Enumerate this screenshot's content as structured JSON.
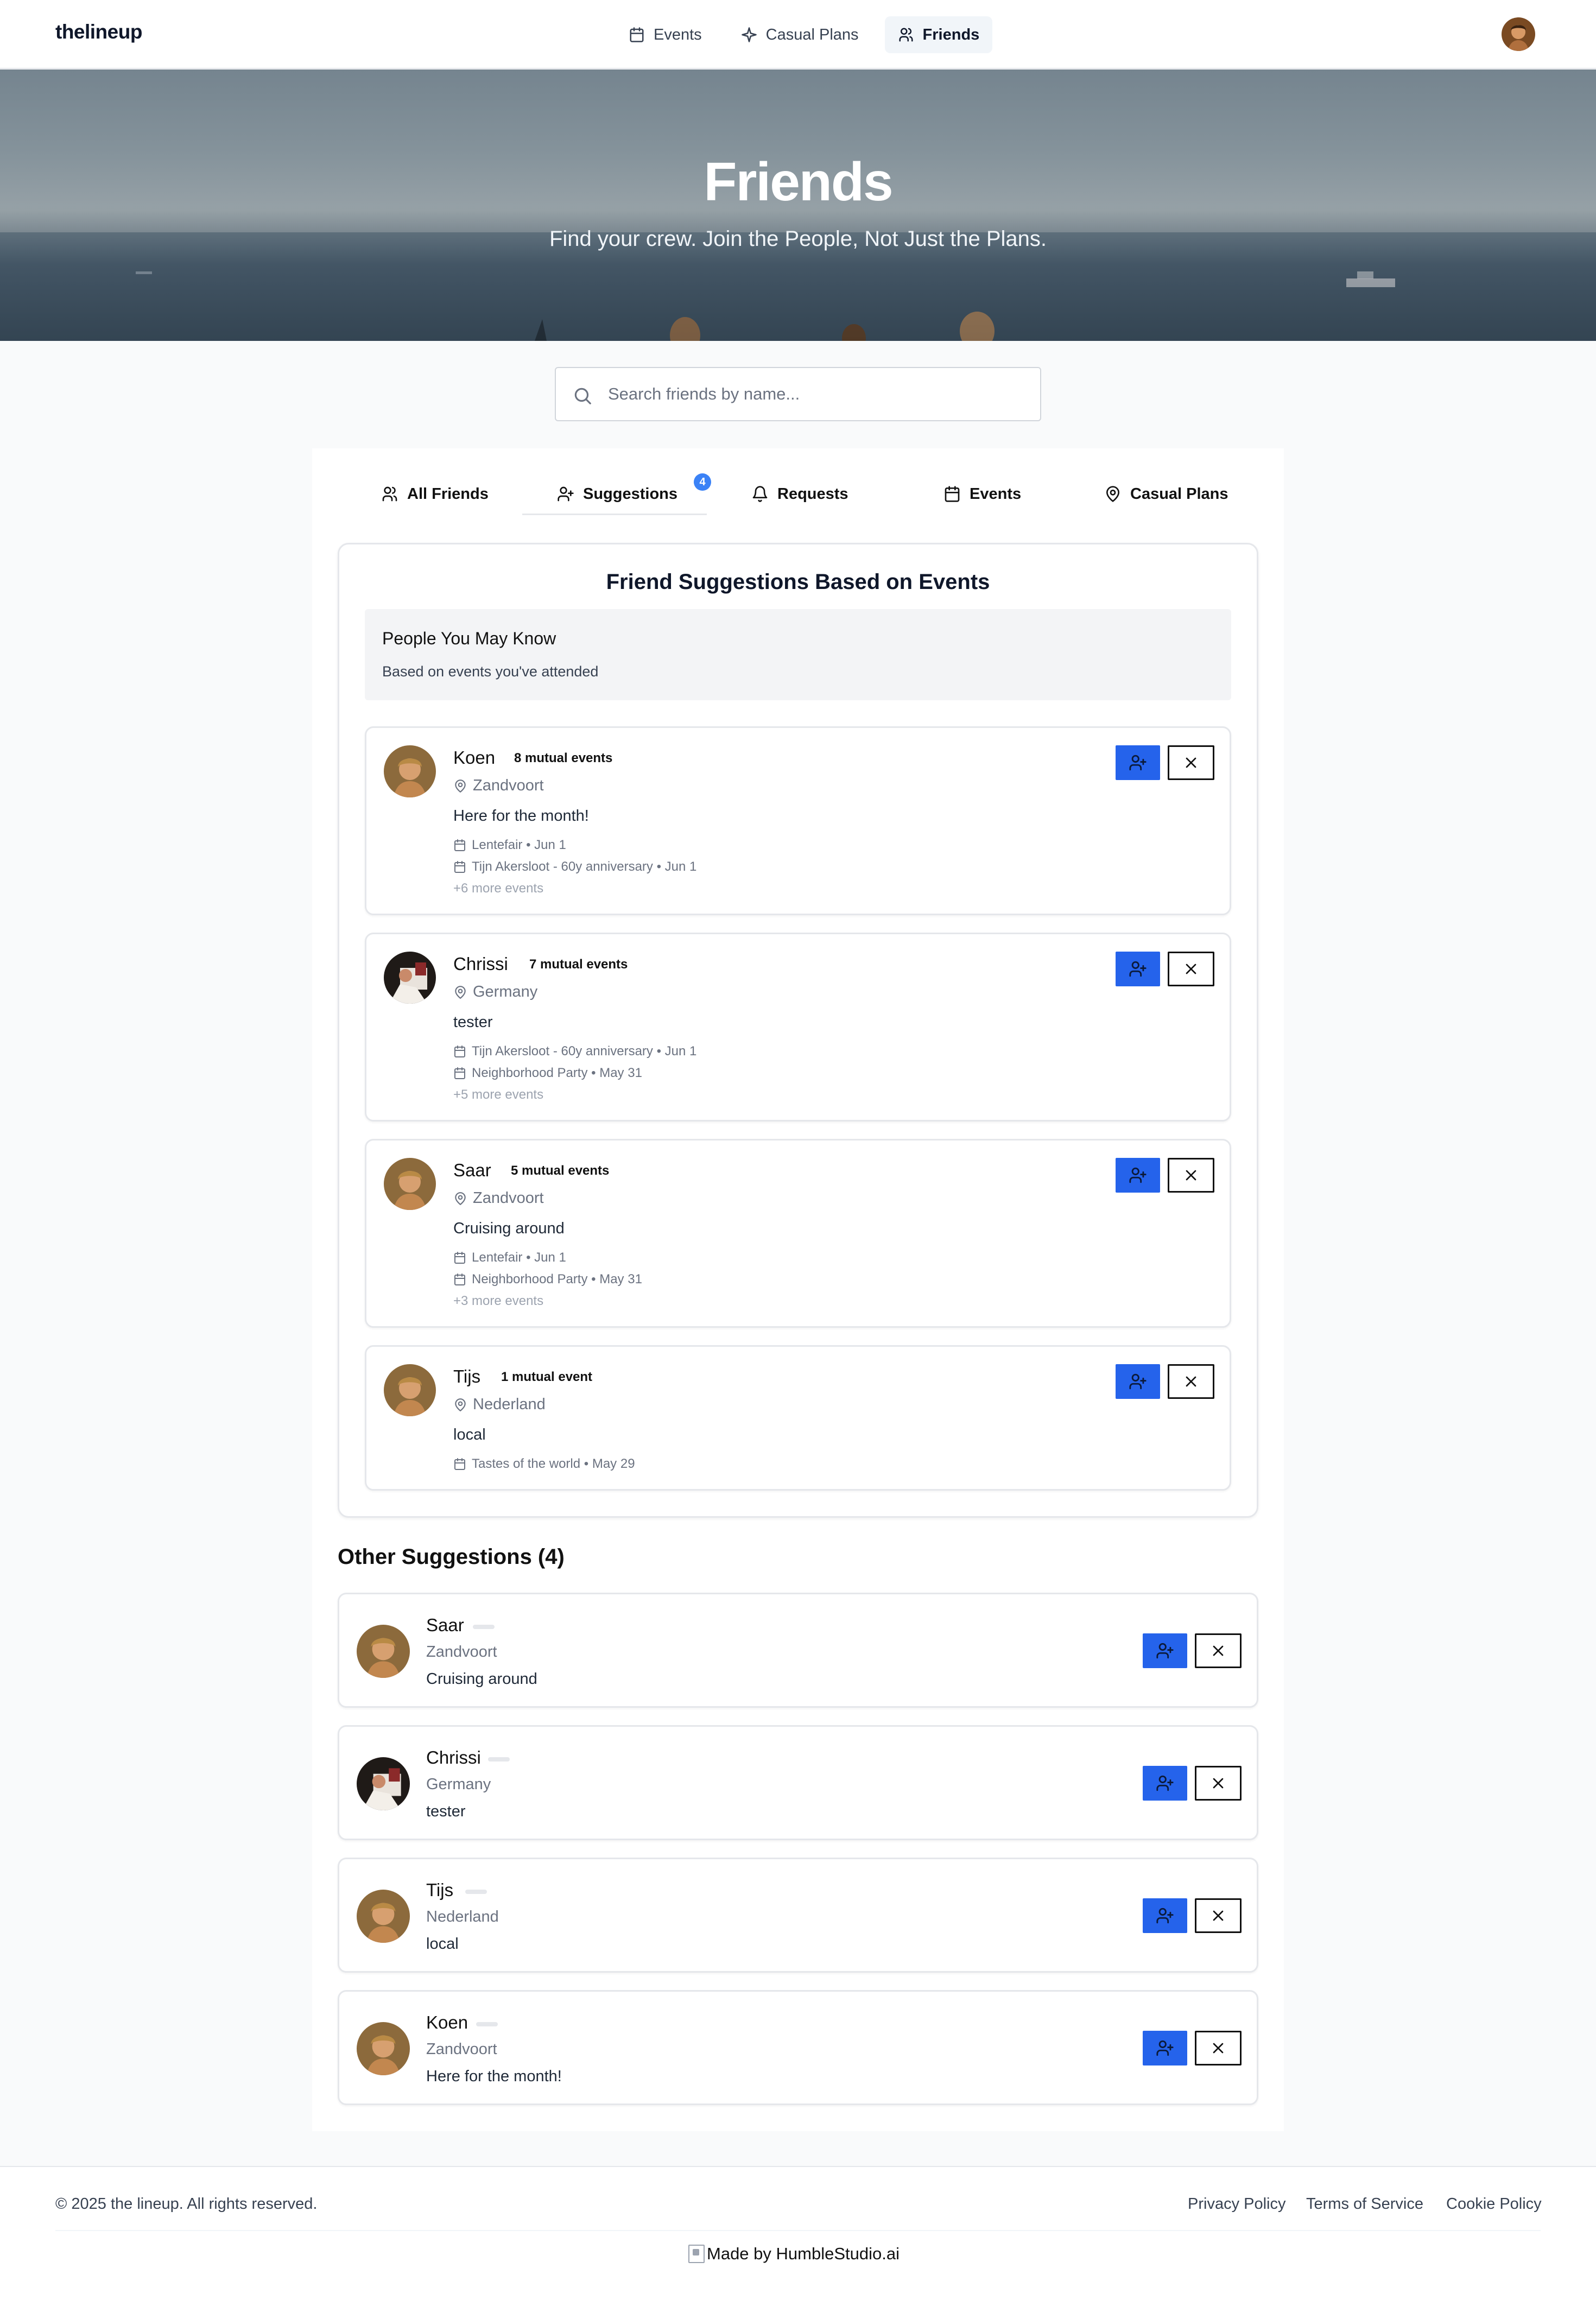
{
  "app": {
    "logo": "thelineup"
  },
  "nav": {
    "links": [
      {
        "label": "Events",
        "icon": "calendar-icon"
      },
      {
        "label": "Casual Plans",
        "icon": "sparkle-icon"
      },
      {
        "label": "Friends",
        "icon": "users-icon",
        "active": true
      }
    ]
  },
  "hero": {
    "title": "Friends",
    "subtitle": "Find your crew. Join the People, Not Just the Plans."
  },
  "search": {
    "placeholder": "Search friends by name...",
    "value": ""
  },
  "tabs": [
    {
      "label": "All Friends",
      "icon": "users-icon"
    },
    {
      "label": "Suggestions",
      "icon": "user-plus-icon",
      "badge": "4",
      "active": true
    },
    {
      "label": "Requests",
      "icon": "bell-icon"
    },
    {
      "label": "Events",
      "icon": "calendar-icon"
    },
    {
      "label": "Casual Plans",
      "icon": "map-pin-icon"
    }
  ],
  "suggestions": {
    "title": "Friend Suggestions Based on Events",
    "header_title": "People You May Know",
    "header_subtitle": "Based on events you've attended",
    "people": [
      {
        "name": "Koen",
        "mutual": "8 mutual events",
        "location": "Zandvoort",
        "bio": "Here for the month!",
        "events": [
          "Lentefair • Jun 1",
          "Tijn Akersloot - 60y anniversary • Jun 1"
        ],
        "more": "+6 more events"
      },
      {
        "name": "Chrissi",
        "mutual": "7 mutual events",
        "location": "Germany",
        "bio": "tester",
        "events": [
          "Tijn Akersloot - 60y anniversary • Jun 1",
          "Neighborhood Party • May 31"
        ],
        "more": "+5 more events"
      },
      {
        "name": "Saar",
        "mutual": "5 mutual events",
        "location": "Zandvoort",
        "bio": "Cruising around",
        "events": [
          "Lentefair • Jun 1",
          "Neighborhood Party • May 31"
        ],
        "more": "+3 more events"
      },
      {
        "name": "Tijs",
        "mutual": "1 mutual event",
        "location": "Nederland",
        "bio": "local",
        "events": [
          "Tastes of the world • May 29"
        ],
        "more": ""
      }
    ]
  },
  "other": {
    "title": "Other Suggestions (4)",
    "people": [
      {
        "name": "Saar",
        "location": "Zandvoort",
        "bio": "Cruising around"
      },
      {
        "name": "Chrissi",
        "location": "Germany",
        "bio": "tester"
      },
      {
        "name": "Tijs",
        "location": "Nederland",
        "bio": "local"
      },
      {
        "name": "Koen",
        "location": "Zandvoort",
        "bio": "Here for the month!"
      }
    ]
  },
  "footer": {
    "copyright": "© 2025 the lineup. All rights reserved.",
    "links": [
      "Privacy Policy",
      "Terms of Service",
      "Cookie Policy"
    ],
    "made_by": "Made by HumbleStudio.ai"
  },
  "colors": {
    "primary": "#2563eb",
    "badge": "#3b82f6",
    "border": "#e5e7eb"
  }
}
